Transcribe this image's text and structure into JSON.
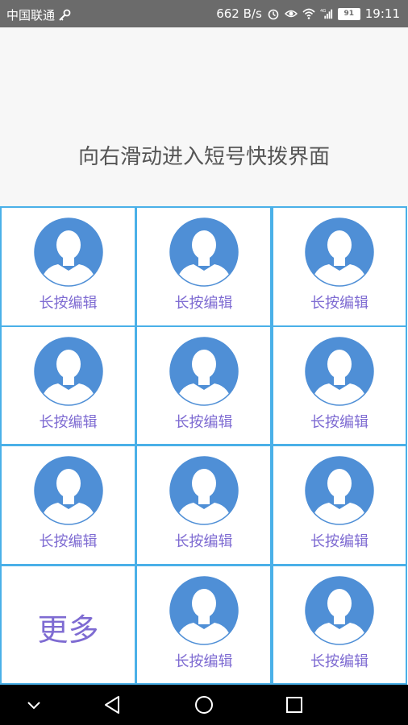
{
  "status_bar": {
    "carrier": "中国联通",
    "net_speed": "662 B/s",
    "network_type": "4G",
    "battery": "91",
    "time": "19:11",
    "icons": [
      "key-icon",
      "alarm-icon",
      "eye-icon",
      "wifi-icon",
      "signal-icon",
      "battery-icon"
    ]
  },
  "header": {
    "hint": "向右滑动进入短号快拨界面"
  },
  "grid": {
    "border_color": "#4ab0e8",
    "label_color": "#7e6bd2",
    "avatar_color": "#4f8fd6",
    "cells": [
      {
        "label": "长按编辑"
      },
      {
        "label": "长按编辑"
      },
      {
        "label": "长按编辑"
      },
      {
        "label": "长按编辑"
      },
      {
        "label": "长按编辑"
      },
      {
        "label": "长按编辑"
      },
      {
        "label": "长按编辑"
      },
      {
        "label": "长按编辑"
      },
      {
        "label": "长按编辑"
      },
      {
        "label": "更多"
      },
      {
        "label": "长按编辑"
      },
      {
        "label": "长按编辑"
      }
    ]
  },
  "nav_bar": {
    "icons": [
      "chevron-down-icon",
      "back-icon",
      "home-icon",
      "recents-icon"
    ]
  }
}
